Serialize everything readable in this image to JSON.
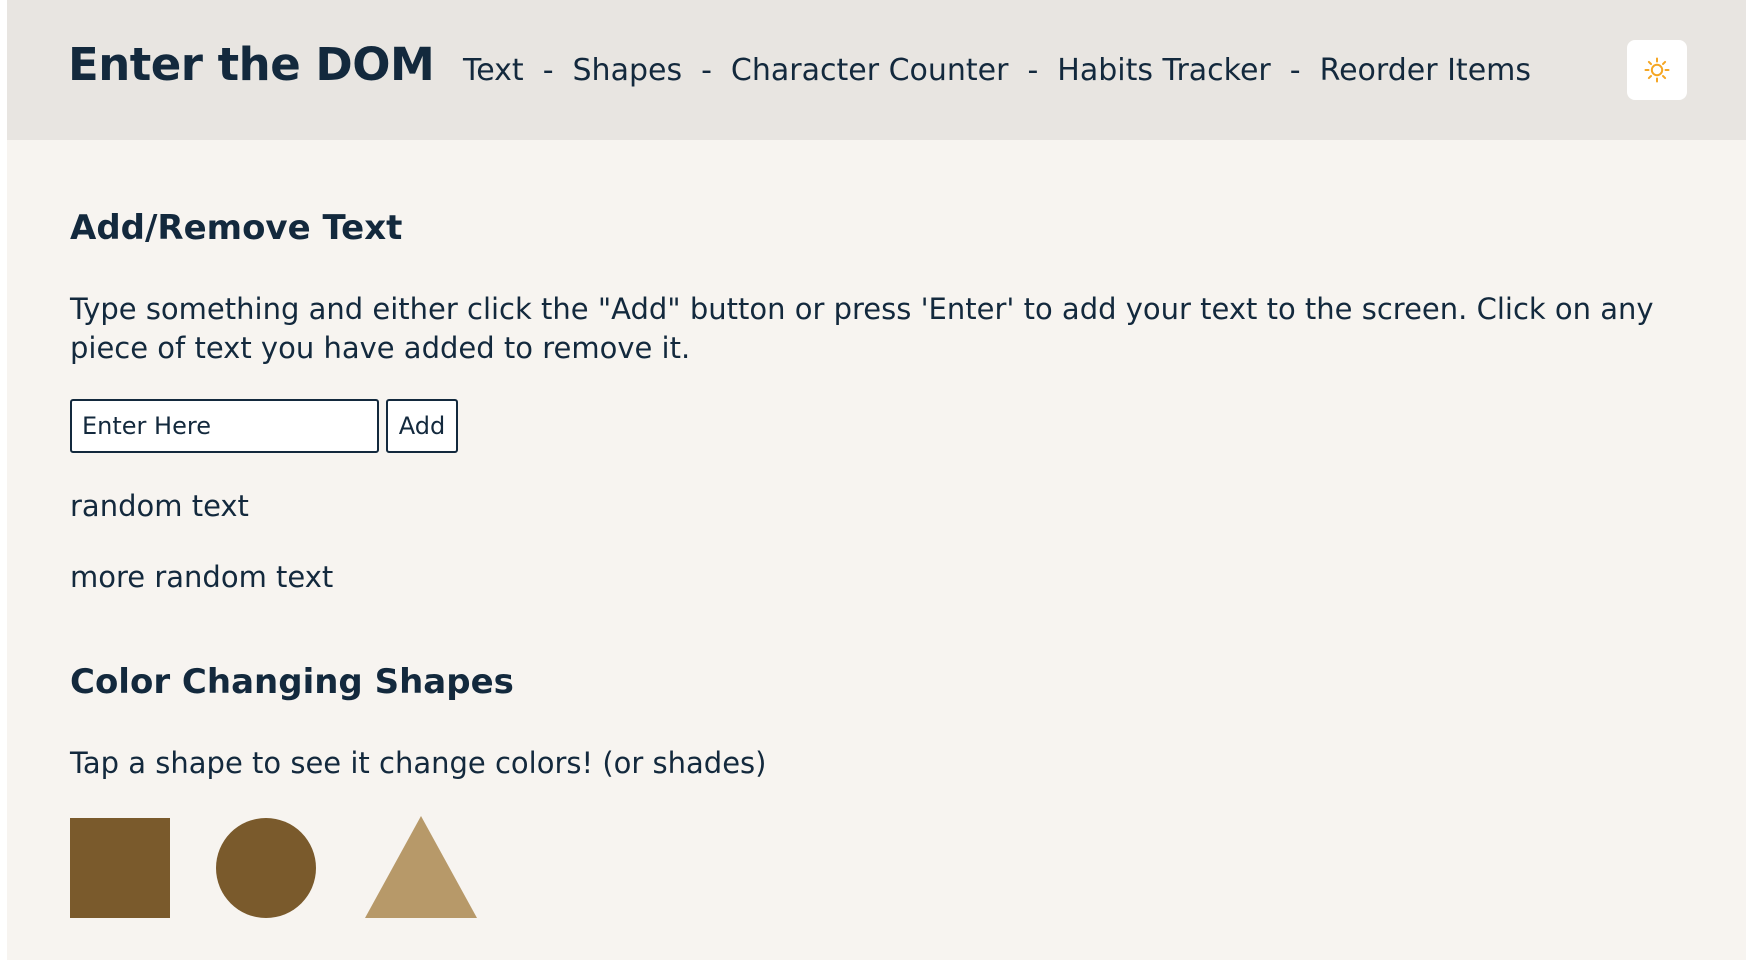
{
  "header": {
    "title": "Enter the DOM",
    "nav": [
      {
        "label": "Text"
      },
      {
        "label": "Shapes"
      },
      {
        "label": "Character Counter"
      },
      {
        "label": "Habits Tracker"
      },
      {
        "label": "Reorder Items"
      }
    ],
    "nav_separator": "-",
    "theme_toggle_icon": "sun-icon",
    "theme_toggle_color": "#f5a623"
  },
  "text_section": {
    "heading": "Add/Remove Text",
    "description": "Type something and either click the \"Add\" button or press 'Enter' to add your text to the screen. Click on any piece of text you have added to remove it.",
    "input_placeholder": "Enter Here",
    "input_value": "",
    "add_button_label": "Add",
    "items": [
      "random text",
      "more random text"
    ]
  },
  "shapes_section": {
    "heading": "Color Changing Shapes",
    "description": "Tap a shape to see it change colors! (or shades)",
    "shapes": [
      {
        "type": "square",
        "color": "#7a5a2c"
      },
      {
        "type": "circle",
        "color": "#7a5a2c"
      },
      {
        "type": "triangle",
        "color": "#b79969"
      }
    ]
  },
  "colors": {
    "text": "#13293d",
    "page_background": "#f7f4f0",
    "header_background": "#e8e5e1"
  }
}
